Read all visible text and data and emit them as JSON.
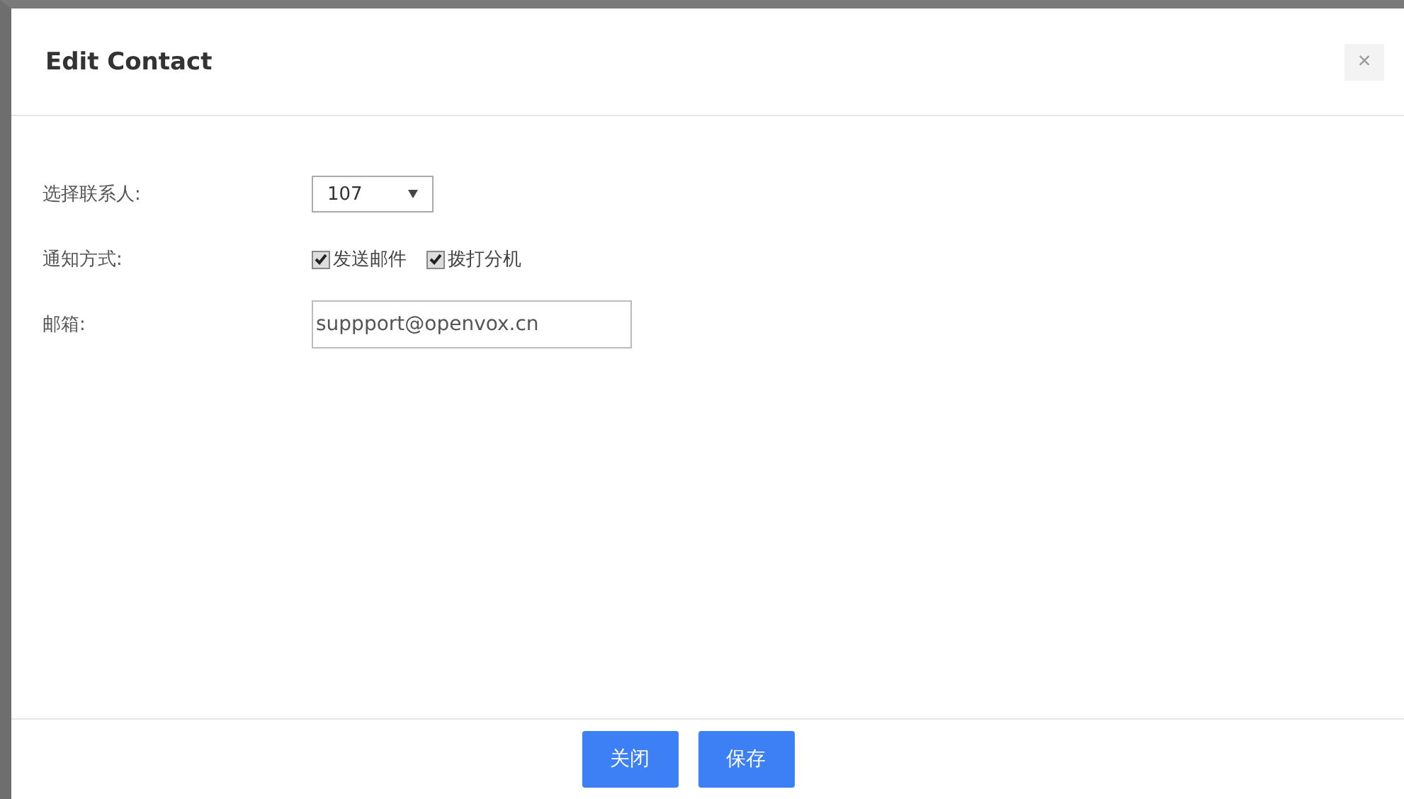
{
  "dialog": {
    "title": "Edit Contact",
    "close": "×"
  },
  "form": {
    "contact": {
      "label": "选择联系人:",
      "value": "107"
    },
    "notify": {
      "label": "通知方式:",
      "options": [
        {
          "label": "发送邮件",
          "checked": true
        },
        {
          "label": "拨打分机",
          "checked": true
        }
      ]
    },
    "email": {
      "label": "邮箱:",
      "value": "suppport@openvox.cn"
    }
  },
  "buttons": [
    "关闭",
    "保存"
  ]
}
